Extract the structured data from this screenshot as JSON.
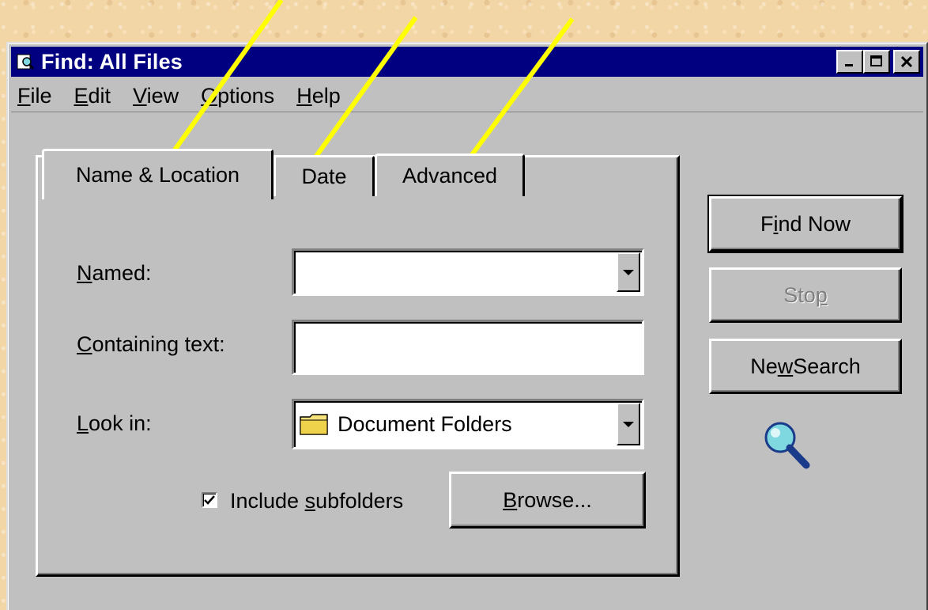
{
  "window": {
    "title": "Find: All Files"
  },
  "menu": [
    {
      "label": "File",
      "underline": "F",
      "rest": "ile"
    },
    {
      "label": "Edit",
      "underline": "E",
      "rest": "dit"
    },
    {
      "label": "View",
      "underline": "V",
      "rest": "iew"
    },
    {
      "label": "Options",
      "underline": "O",
      "rest": "ptions"
    },
    {
      "label": "Help",
      "underline": "H",
      "rest": "elp"
    }
  ],
  "tabs": [
    "Name & Location",
    "Date",
    "Advanced"
  ],
  "form": {
    "named_label_u": "N",
    "named_label_rest": "amed:",
    "named_value": "",
    "containing_label_u": "C",
    "containing_label_rest": "ontaining text:",
    "containing_value": "",
    "lookin_label_u": "L",
    "lookin_label_rest": "ook in:",
    "lookin_value": "Document Folders",
    "include_pre": "Include ",
    "include_u": "s",
    "include_rest": "ubfolders",
    "include_checked": true,
    "browse_u": "B",
    "browse_rest": "rowse..."
  },
  "buttons": {
    "find_pre": "F",
    "find_u": "i",
    "find_rest": "nd Now",
    "stop_pre": "Sto",
    "stop_u": "p",
    "new_pre": "Ne",
    "new_u": "w",
    "new_rest": " Search"
  },
  "colors": {
    "arrow": "#ffff00",
    "titlebar": "#000080",
    "face": "#c0c0c0"
  },
  "icons": [
    "find-app-icon",
    "folder-icon",
    "magnifier-icon",
    "minimize-icon",
    "maximize-icon",
    "close-icon"
  ]
}
